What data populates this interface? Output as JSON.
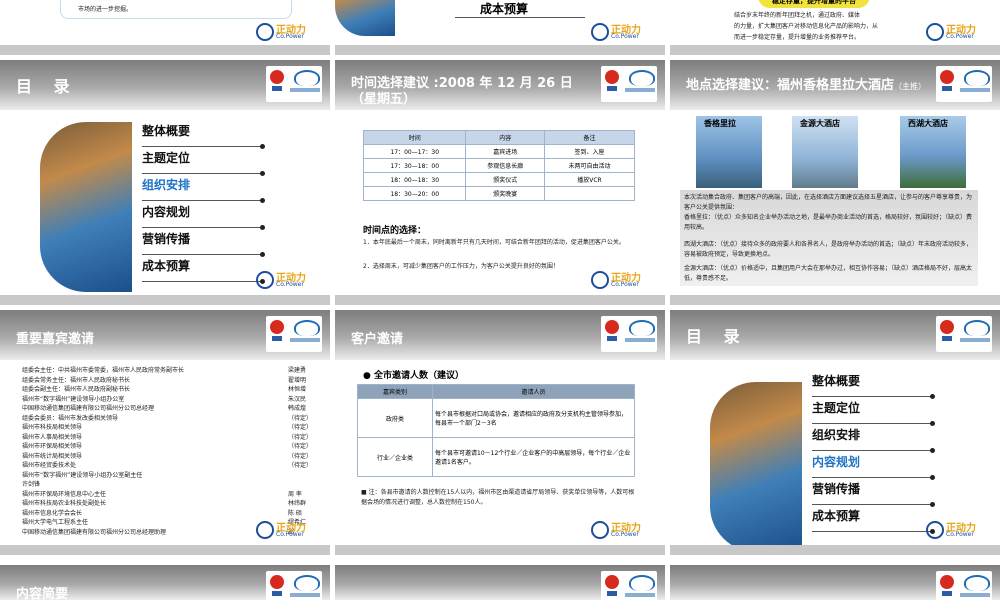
{
  "top_row": {
    "s1_text": "市场的进一步挖掘。",
    "s2_text": "成本预算",
    "s3_badge": "稳定存量，提升增量的平台",
    "s3_lines": [
      "结合岁末年终的新年团拜之机，通过政府、媒体",
      "的力量，扩大集团客户对移动信息化产品的影响力，从",
      "而进一步稳定存量，提升增量的业务推荐平台。"
    ]
  },
  "copower": {
    "cn": "正动力",
    "en": "Co.Power"
  },
  "slide_toc_1": {
    "title": "目  录",
    "items": [
      "整体概要",
      "主题定位",
      "组织安排",
      "内容规划",
      "营销传播",
      "成本预算"
    ],
    "active_index": 2
  },
  "slide_time": {
    "title": "时间选择建议 :2008 年 12 月 26 日（星期五）",
    "headers": [
      "时间",
      "内容",
      "备注"
    ],
    "rows": [
      [
        "17：00—17：30",
        "嘉宾进场",
        "签到、入座"
      ],
      [
        "17：30—18：00",
        "参观信息长廊",
        "未两可自由活动"
      ],
      [
        "18：00—18：30",
        "颁奖仪式",
        "播放VCR"
      ],
      [
        "18：30—20：00",
        "颁奖晚宴",
        ""
      ]
    ],
    "subhead": "时间点的选择：",
    "p1": "1．本年底最后一个周末，同时离新年只有几天时间，可结合新年团拜的活动，促进集团客户公关。",
    "p2": "2．选择周末，可减少集团客户的工作压力，为客户公关提升良好的氛围！"
  },
  "slide_place": {
    "title": "地点选择建议：福州香格里拉大酒店",
    "title_tag": "（主推）",
    "hotels": [
      "香格里拉",
      "金源大酒店",
      "西湖大酒店"
    ],
    "intro": "本次活动集合政府、集团客户的高端，因此，在选择酒店方面建议选择五星酒店，让参与的客户尊享尊贵，为客户公关提供氛围：",
    "p1": "香格里拉：（优点）众多知名企业举办活动之地，是最举办商业活动的首选，格局较好，氛围较好；（缺点）费用较高。",
    "p2": "西湖大酒店：（优点）接待众多的政府要人和各界名人，是政府举办活动的首选；（缺点）年末政府活动较多，容易被政府预定，导致更换地点。",
    "p3": "金源大酒店：（优点）价格适中，且集团用户大会在那举办过，相互协作容易；（缺点）酒店格局不好，层高太低，尊贵感不足。"
  },
  "slide_guests": {
    "title": "重要嘉宾邀请",
    "rows": [
      [
        "组委会主任：中共福州市委常委，福州市人民政府常务副市长",
        "梁建勇"
      ],
      [
        "组委会常务主任：福州市人民政府秘书长",
        "翟增明"
      ],
      [
        "组委会副主任：福州市人民政府副秘书长",
        "林恒增"
      ],
      [
        "福州市“数字福州”建设领导小组办公室",
        "朱汉民"
      ],
      [
        "中国移动通信集团福建有限公司福州分公司总经理",
        "韩成煌"
      ],
      [
        "组委会委员：福州市发改委相关领导",
        "（待定）"
      ],
      [
        "福州市科技局相关领导",
        "（待定）"
      ],
      [
        "福州市人事局相关领导",
        "（待定）"
      ],
      [
        "福州市环保局相关领导",
        "（待定）"
      ],
      [
        "福州市统计局相关领导",
        "（待定）"
      ],
      [
        "福州市经贸委技术处",
        "（待定）"
      ],
      [
        "福州市“数字福州”建设领导小组办公室副主任",
        ""
      ],
      [
        "许剑锋",
        ""
      ],
      [
        "福州市环保局环境信息中心主任",
        "周  率"
      ],
      [
        "福州市科技局农业科技处副处长",
        "林纬群"
      ],
      [
        "福州市信息化学会会长",
        "陈  硕"
      ],
      [
        "福州大学电气工程系主任",
        "缪希仁"
      ],
      [
        "中国移动通信集团福建有限公司福州分公司总经理助理",
        "郑"
      ]
    ]
  },
  "slide_invite": {
    "title": "客户邀请",
    "bullet": "全市邀请人数（建议）",
    "headers": [
      "嘉宾类别",
      "邀请人员"
    ],
    "rows": [
      [
        "政府类",
        "每个县市根据对口局或协会，邀请相应的政府及分支机构主管领导参加，每县市一个部门2－3名"
      ],
      [
        "行业／企业类",
        "每个县市可邀请10－12个行业／企业客户的中高层领导，每个行业／企业邀请1名客户。"
      ]
    ],
    "note": "注：各县市邀请的人数控制在15人以内，福州市区由渠道请省厅局领导、获奖单位领导等，人数可根据会场的情况进行调整，总人数控制在150人。"
  },
  "slide_toc_2": {
    "title": "目  录",
    "items": [
      "整体概要",
      "主题定位",
      "组织安排",
      "内容规划",
      "营销传播",
      "成本预算"
    ],
    "active_index": 3
  },
  "bottom_row": {
    "s7_title": "内容简要"
  },
  "colors": {
    "active": "#1e73c6",
    "header_dark": "#7d7d7d",
    "table_head": "#c6d6e8"
  }
}
